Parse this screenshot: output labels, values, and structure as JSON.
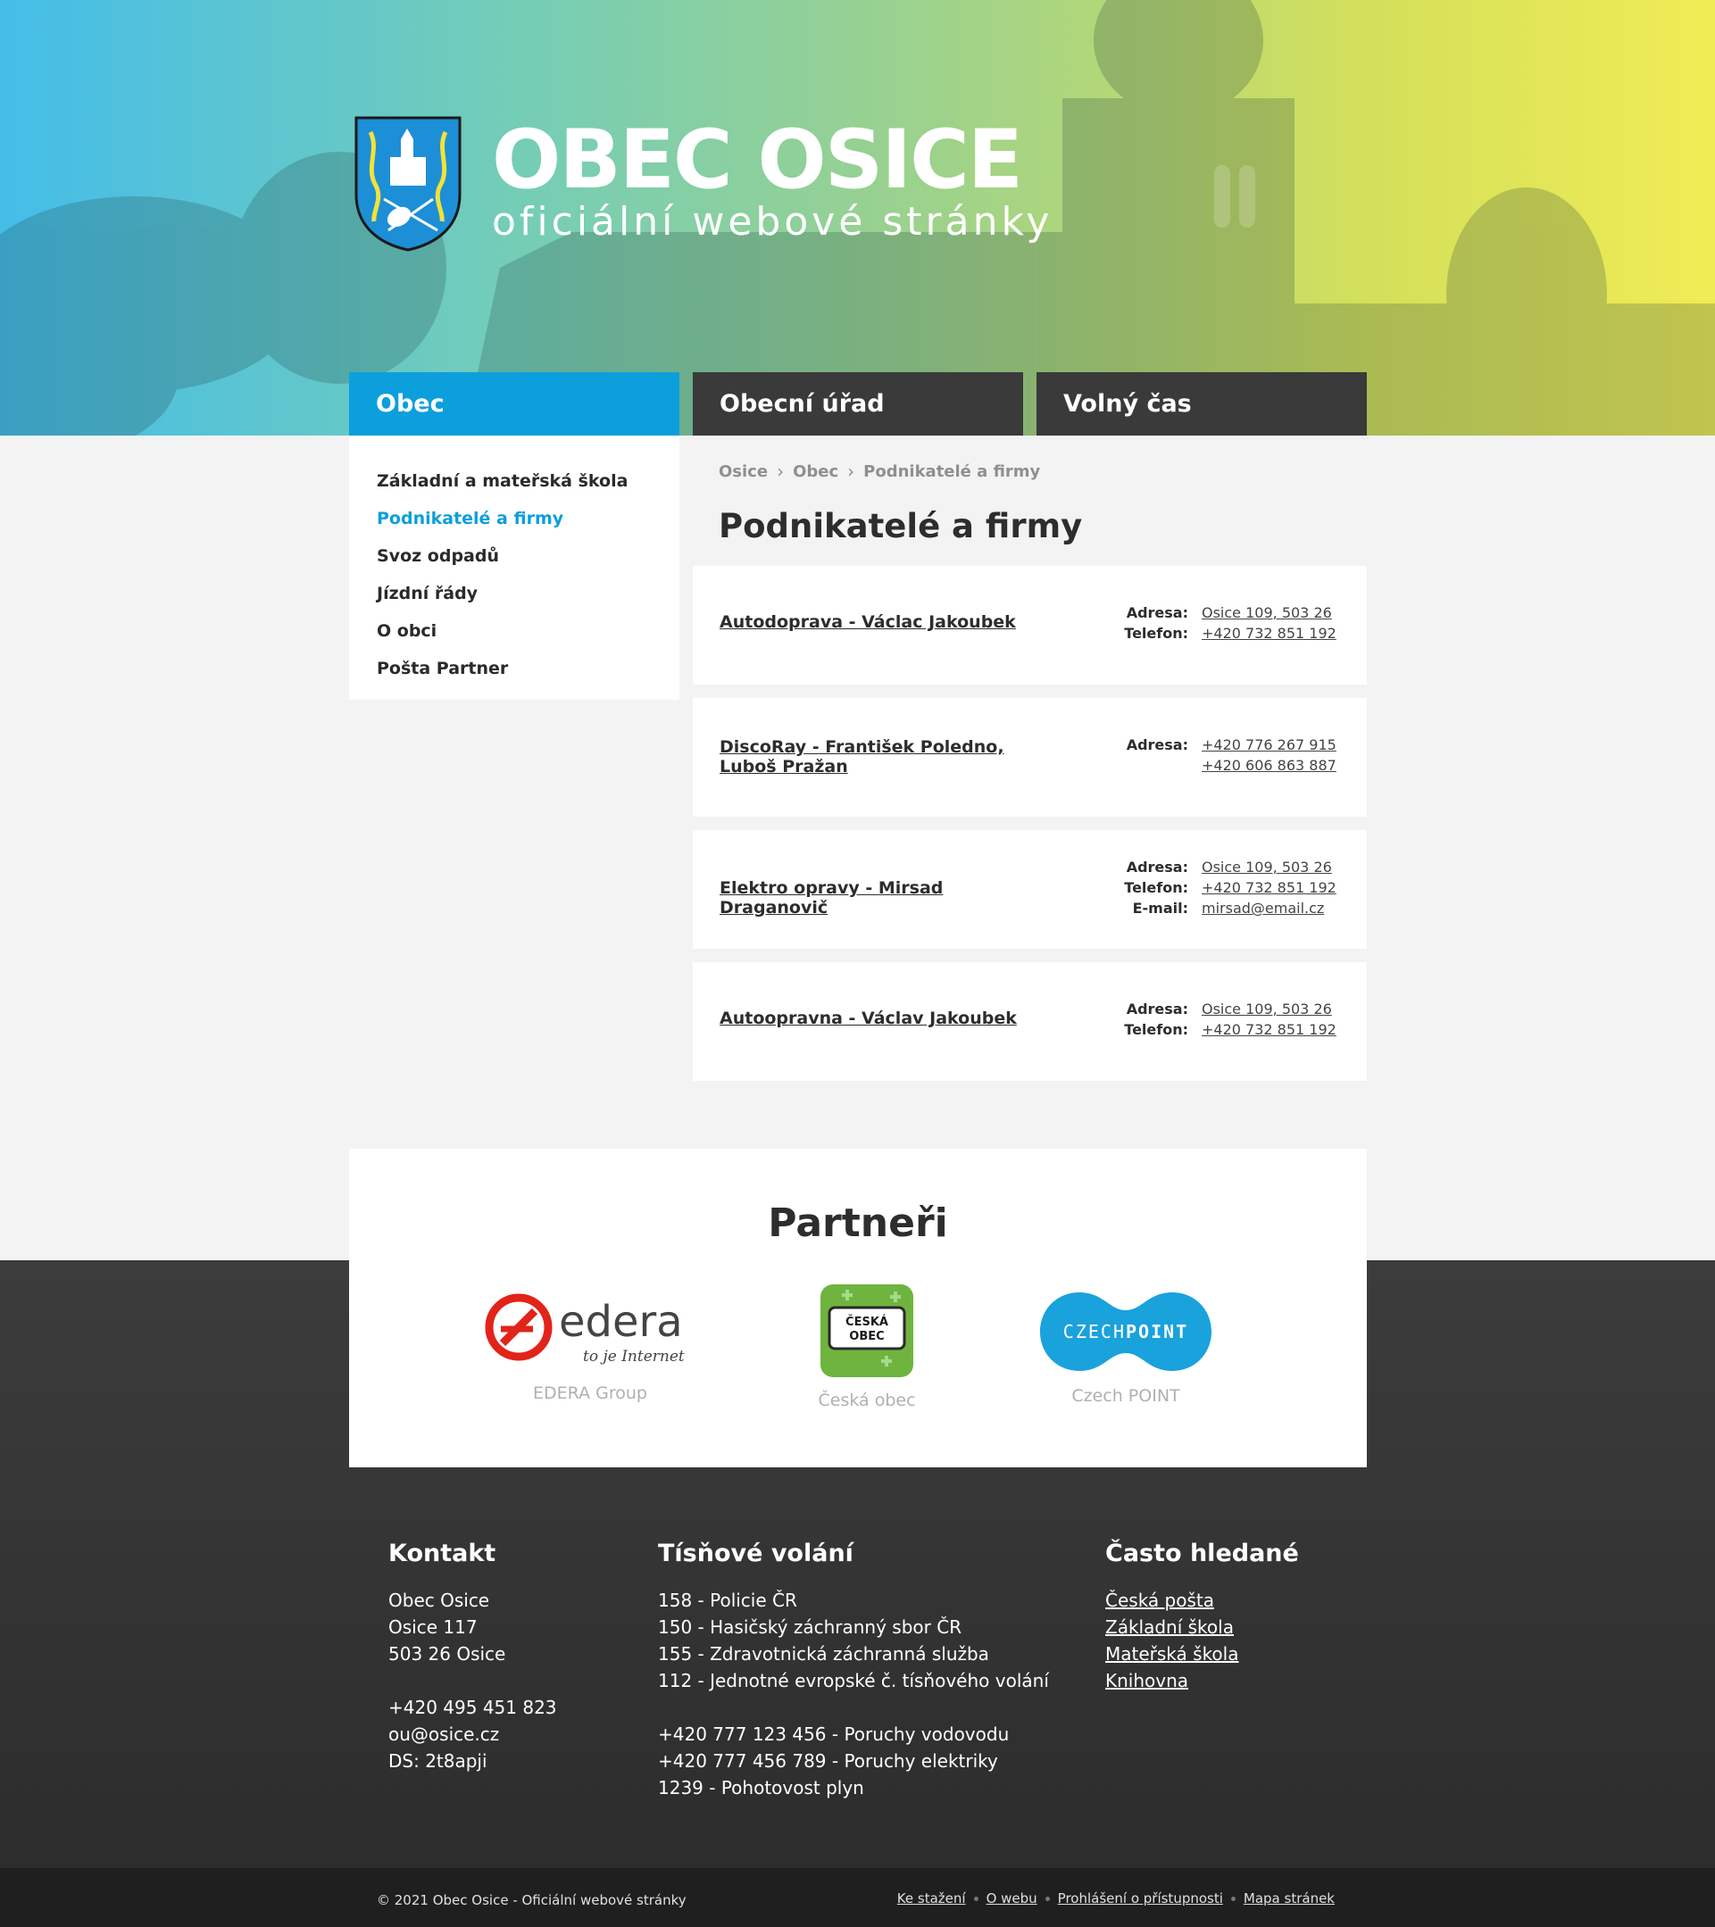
{
  "site": {
    "title": "OBEC OSICE",
    "subtitle": "oficiální webové stránky"
  },
  "nav": {
    "tabs": [
      {
        "label": "Obec"
      },
      {
        "label": "Obecní úřad"
      },
      {
        "label": "Volný čas"
      }
    ]
  },
  "sidebar": {
    "items": [
      {
        "label": "Základní a mateřská škola"
      },
      {
        "label": "Podnikatelé a firmy"
      },
      {
        "label": "Svoz odpadů"
      },
      {
        "label": "Jízdní řády"
      },
      {
        "label": "O obci"
      },
      {
        "label": "Pošta Partner"
      }
    ]
  },
  "breadcrumb": [
    "Osice",
    "Obec",
    "Podnikatelé a firmy"
  ],
  "page": {
    "title": "Podnikatelé a firmy"
  },
  "businesses": [
    {
      "name": "Autodoprava - Václac Jakoubek",
      "rows": [
        {
          "label": "Adresa:",
          "value": "Osice 109, 503 26"
        },
        {
          "label": "Telefon:",
          "value": "+420 732 851 192"
        }
      ]
    },
    {
      "name": "DiscoRay - František Poledno, Luboš Pražan",
      "rows": [
        {
          "label": "Adresa:",
          "value": "+420 776 267 915"
        },
        {
          "label": "",
          "value": "+420 606 863 887"
        }
      ]
    },
    {
      "name": "Elektro opravy - Mirsad Draganovič",
      "rows": [
        {
          "label": "Adresa:",
          "value": "Osice 109, 503 26"
        },
        {
          "label": "Telefon:",
          "value": "+420 732 851 192"
        },
        {
          "label": "E-mail:",
          "value": "mirsad@email.cz"
        }
      ]
    },
    {
      "name": "Autoopravna - Václav Jakoubek",
      "rows": [
        {
          "label": "Adresa:",
          "value": "Osice 109, 503 26"
        },
        {
          "label": "Telefon:",
          "value": "+420 732 851 192"
        }
      ]
    }
  ],
  "partners": {
    "title": "Partneři",
    "items": [
      {
        "name": "EDERA Group",
        "logo_text": "edera",
        "logo_tagline": "to je Internet",
        "icon": "edera-logo"
      },
      {
        "name": "Česká obec",
        "logo_text": "ČESKÁ OBEC",
        "icon": "ceska-obec-logo"
      },
      {
        "name": "Czech POINT",
        "logo_text": "CZECHPOINT",
        "icon": "czechpoint-logo"
      }
    ]
  },
  "footer": {
    "contact": {
      "title": "Kontakt",
      "lines": [
        "Obec Osice",
        "Osice 117",
        "503 26 Osice",
        "",
        "+420 495 451 823",
        "ou@osice.cz",
        "DS: 2t8apji"
      ]
    },
    "emergency": {
      "title": "Tísňové volání",
      "lines": [
        "158 - Policie ČR",
        "150 - Hasičský záchranný sbor ČR",
        "155 - Zdravotnická záchranná služba",
        "112 - Jednotné evropské č. tísňového volání",
        "",
        "+420 777 123 456 - Poruchy vodovodu",
        "+420 777 456 789 - Poruchy elektriky",
        "1239 - Pohotovost plyn"
      ]
    },
    "frequent": {
      "title": "Často hledané",
      "links": [
        "Česká pošta",
        "Základní škola",
        "Mateřská škola",
        "Knihovna"
      ]
    },
    "copyright": "© 2021 Obec Osice - Oficiální webové stránky",
    "links": [
      "Ke stažení",
      "O webu",
      "Prohlášení o přístupnosti",
      "Mapa stránek"
    ]
  },
  "colors": {
    "accent": "#0c9fdc",
    "nav_dark": "#3a3a3a",
    "footer_dark": "#2b2b2b",
    "gradient_start": "#44bde9",
    "gradient_end": "#f0ec55"
  }
}
